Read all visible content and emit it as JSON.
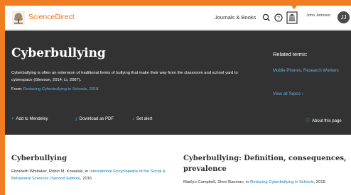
{
  "header": {
    "brand": "ScienceDirect",
    "journals_link": "Journals & Books",
    "user_name": "John Johnson",
    "avatar_initial": "JJ"
  },
  "hero": {
    "title": "Cyberbullying",
    "description": "Cyberbullying is often an extension of traditional forms of bullying that make their way from the classroom and school yard to cyberspace (Gleeson, 2014; Li, 2007).",
    "from_label": "From:",
    "from_link": "Reducing Cyberbullying in Schools, 2018",
    "related_title": "Related terms:",
    "related_terms": [
      "Mobile Phones, Research Workers"
    ],
    "view_all": "View all Topics"
  },
  "actions": {
    "add_mendeley": "Add to Mendeley",
    "download_pdf": "Download as PDF",
    "set_alert": "Set alert",
    "about": "About this page"
  },
  "cards": [
    {
      "title": "Cyberbullying",
      "authors": "Elizabeth Whittaker, Robin M. Kowalski, in",
      "source_link": "International Encyclopedia of the Social & Behavioral Sciences (Second Edition)",
      "year": ", 2015"
    },
    {
      "title": "Cyberbullying: Definition, consequences, prevalence",
      "authors": "Marilyn Campbell, Sheri Bauman, in",
      "source_link": "Reducing Cyberbullying in Schools",
      "year": ", 2018"
    }
  ],
  "colors": {
    "accent_orange": "#f07d22",
    "brand_orange": "#e9711c",
    "hero_bg": "#323232",
    "link_blue": "#62b4e5",
    "card_link_blue": "#0c7dbb"
  },
  "icons": {
    "logo": "elsevier-tree-logo",
    "search": "search-icon",
    "help": "help-icon",
    "institution": "institution-icon",
    "add": "plus-icon",
    "download": "download-icon",
    "alert": "bell-icon",
    "info": "info-icon",
    "chevron": "chevron-right-icon"
  }
}
